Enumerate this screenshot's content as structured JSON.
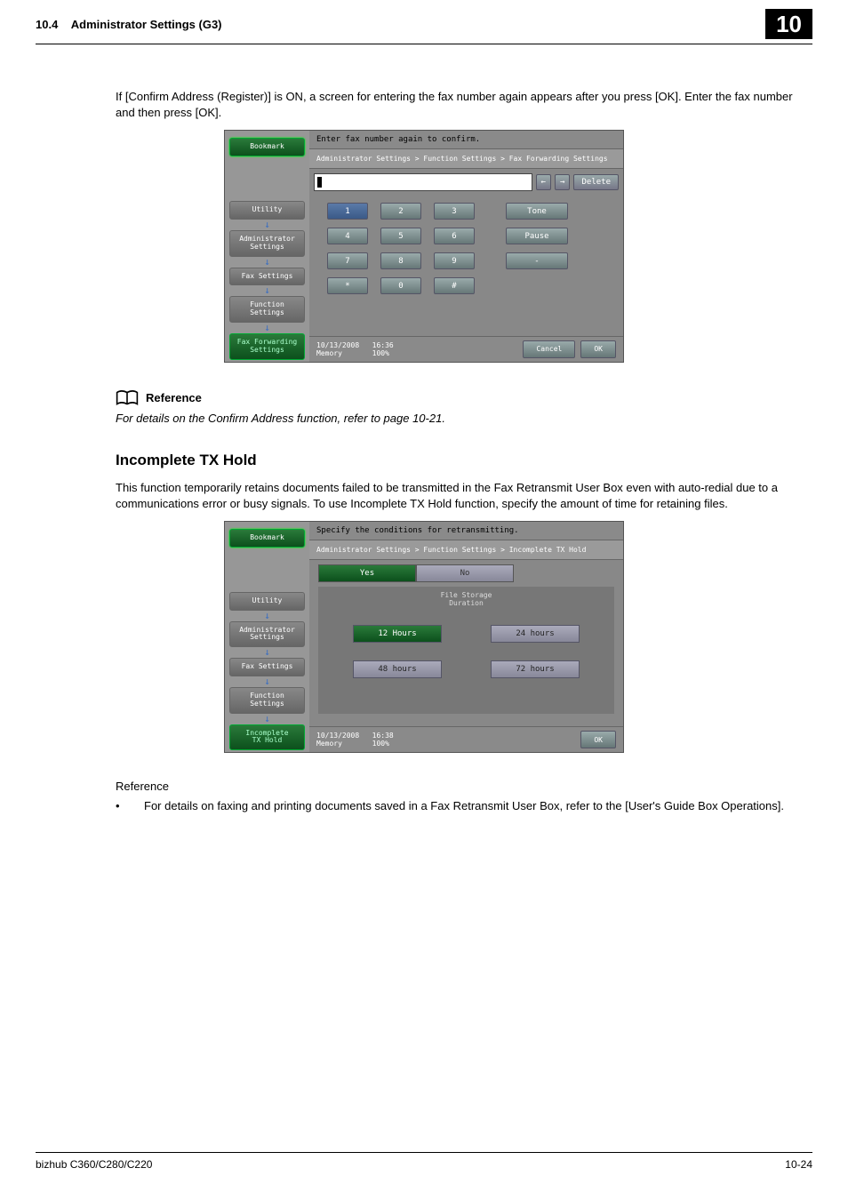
{
  "header": {
    "section": "10.4",
    "title": "Administrator Settings (G3)",
    "chapter": "10"
  },
  "intro": "If [Confirm Address (Register)] is ON, a screen for entering the fax number again appears after you press [OK]. Enter the fax number and then press [OK].",
  "ss1": {
    "instruction": "Enter fax number again to confirm.",
    "breadcrumb": "Administrator Settings > Function Settings > Fax Forwarding Settings",
    "bookmark": "Bookmark",
    "nav": [
      "Utility",
      "Administrator\nSettings",
      "Fax Settings",
      "Function\nSettings"
    ],
    "nav_active": "Fax Forwarding\nSettings",
    "arrows": {
      "left": "←",
      "right": "→"
    },
    "delete": "Delete",
    "keys": [
      "1",
      "2",
      "3",
      "4",
      "5",
      "6",
      "7",
      "8",
      "9",
      "*",
      "0",
      "#"
    ],
    "side": [
      "Tone",
      "Pause",
      "-"
    ],
    "date": "10/13/2008",
    "time": "16:36",
    "mem_label": "Memory",
    "mem": "100%",
    "cancel": "Cancel",
    "ok": "OK"
  },
  "reference1": {
    "heading": "Reference",
    "text": "For details on the Confirm Address function, refer to page 10-21."
  },
  "section2": {
    "title": "Incomplete TX Hold",
    "desc": "This function temporarily retains documents failed to be transmitted in the Fax Retransmit User Box even with auto-redial due to a communications error or busy signals. To use Incomplete TX Hold function, specify the amount of time for retaining files."
  },
  "ss2": {
    "instruction": "Specify the conditions for retransmitting.",
    "breadcrumb": "Administrator Settings > Function Settings > Incomplete TX Hold",
    "bookmark": "Bookmark",
    "nav": [
      "Utility",
      "Administrator\nSettings",
      "Fax Settings",
      "Function\nSettings"
    ],
    "nav_active": "Incomplete\nTX Hold",
    "yes": "Yes",
    "no": "No",
    "storage_title": "File Storage\nDuration",
    "opts": [
      "12 Hours",
      "24 hours",
      "48 hours",
      "72 hours"
    ],
    "date": "10/13/2008",
    "time": "16:38",
    "mem_label": "Memory",
    "mem": "100%",
    "ok": "OK"
  },
  "reference2": {
    "label": "Reference",
    "bullet": "For details on faxing and printing documents saved in a Fax Retransmit User Box, refer to the [User's Guide Box Operations]."
  },
  "footer": {
    "model": "bizhub C360/C280/C220",
    "page": "10-24"
  }
}
